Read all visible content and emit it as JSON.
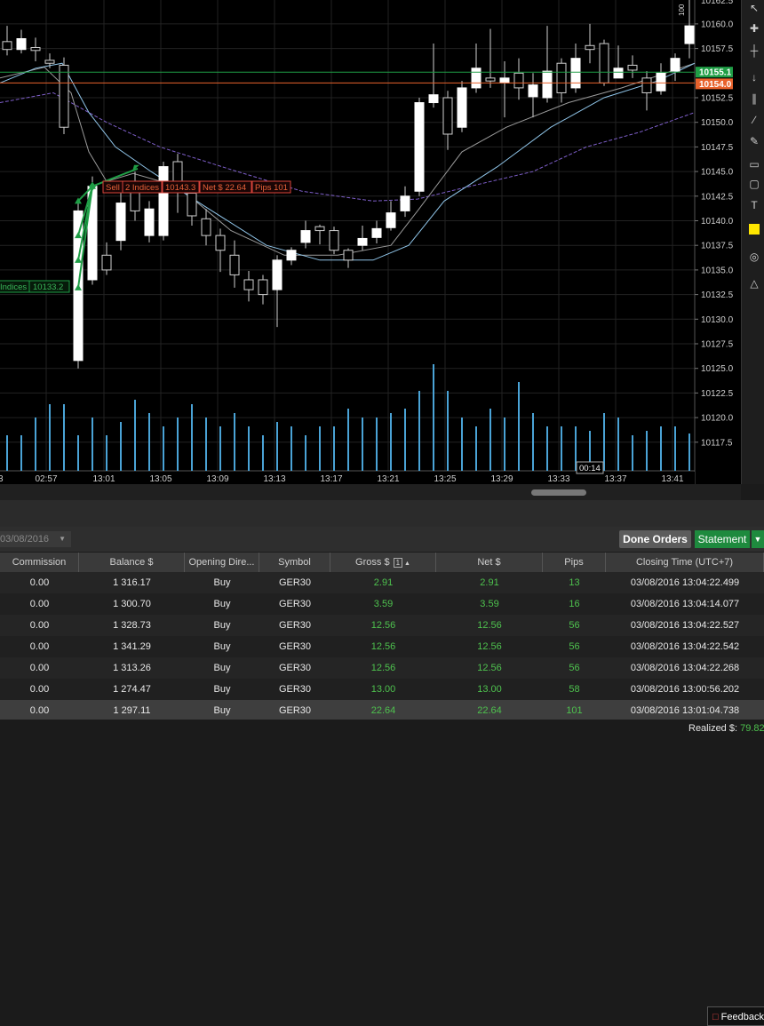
{
  "chart": {
    "price_ticks": [
      "10160.0",
      "10157.5",
      "10152.5",
      "10150.0",
      "10147.5",
      "10145.0",
      "10142.5",
      "10140.0",
      "10137.5",
      "10135.0",
      "10132.5",
      "10130.0",
      "10127.5",
      "10125.0",
      "10122.5",
      "10120.0",
      "10117.5"
    ],
    "price_tick_values": [
      10160.0,
      10157.5,
      10152.5,
      10150.0,
      10147.5,
      10145.0,
      10142.5,
      10140.0,
      10137.5,
      10135.0,
      10132.5,
      10130.0,
      10127.5,
      10125.0,
      10122.5,
      10120.0,
      10117.5
    ],
    "top_label": "10162.5",
    "time_ticks": [
      "02:57",
      "13:01",
      "13:05",
      "13:09",
      "13:13",
      "13:17",
      "13:21",
      "13:25",
      "13:29",
      "13:33",
      "13:37",
      "13:41"
    ],
    "bid_price": "10155.1",
    "ask_price": "10154.0",
    "countdown": "00:14",
    "vertical_tag": "100",
    "trade_label": {
      "side": "Sell",
      "size": "2 Indices",
      "price": "10143.3",
      "net": "Net $ 22.64",
      "pips": "Pips 101"
    },
    "entry_label": {
      "size": "Indices",
      "price": "10133.2"
    },
    "colors": {
      "bid": "#1f9e46",
      "ask": "#e8622c",
      "candle_up": "#ffffff",
      "volume": "#4aa3d6",
      "ma_fast": "#8fc4e8",
      "ma_slow": "#9a9a9a",
      "ma_long": "#7d5ec8"
    }
  },
  "toolbar_icons": [
    "cursor-icon",
    "crosshair-icon",
    "cross-icon",
    "vertical-line-icon",
    "channel-icon",
    "trendline-icon",
    "pen-icon",
    "rectangle-icon",
    "rectangle-alt-icon",
    "text-icon",
    "color-swatch-icon",
    "magnet-icon",
    "bell-icon"
  ],
  "feedback_label": "Feedback",
  "filter": {
    "date": "03/08/2016"
  },
  "buttons": {
    "done_orders": "Done Orders",
    "statement": "Statement"
  },
  "table": {
    "columns": [
      "Commission",
      "Balance $",
      "Opening Dire...",
      "Symbol",
      "Gross $",
      "Net $",
      "Pips",
      "Closing Time (UTC+7)"
    ],
    "sort_index": "1",
    "rows": [
      [
        "0.00",
        "1 316.17",
        "Buy",
        "GER30",
        "2.91",
        "2.91",
        "13",
        "03/08/2016 13:04:22.499"
      ],
      [
        "0.00",
        "1 300.70",
        "Buy",
        "GER30",
        "3.59",
        "3.59",
        "16",
        "03/08/2016 13:04:14.077"
      ],
      [
        "0.00",
        "1 328.73",
        "Buy",
        "GER30",
        "12.56",
        "12.56",
        "56",
        "03/08/2016 13:04:22.527"
      ],
      [
        "0.00",
        "1 341.29",
        "Buy",
        "GER30",
        "12.56",
        "12.56",
        "56",
        "03/08/2016 13:04:22.542"
      ],
      [
        "0.00",
        "1 313.26",
        "Buy",
        "GER30",
        "12.56",
        "12.56",
        "56",
        "03/08/2016 13:04:22.268"
      ],
      [
        "0.00",
        "1 274.47",
        "Buy",
        "GER30",
        "13.00",
        "13.00",
        "58",
        "03/08/2016 13:00:56.202"
      ],
      [
        "0.00",
        "1 297.11",
        "Buy",
        "GER30",
        "22.64",
        "22.64",
        "101",
        "03/08/2016 13:01:04.738"
      ]
    ]
  },
  "status": {
    "realized_label": "Realized $:",
    "realized_value": "79.82"
  }
}
